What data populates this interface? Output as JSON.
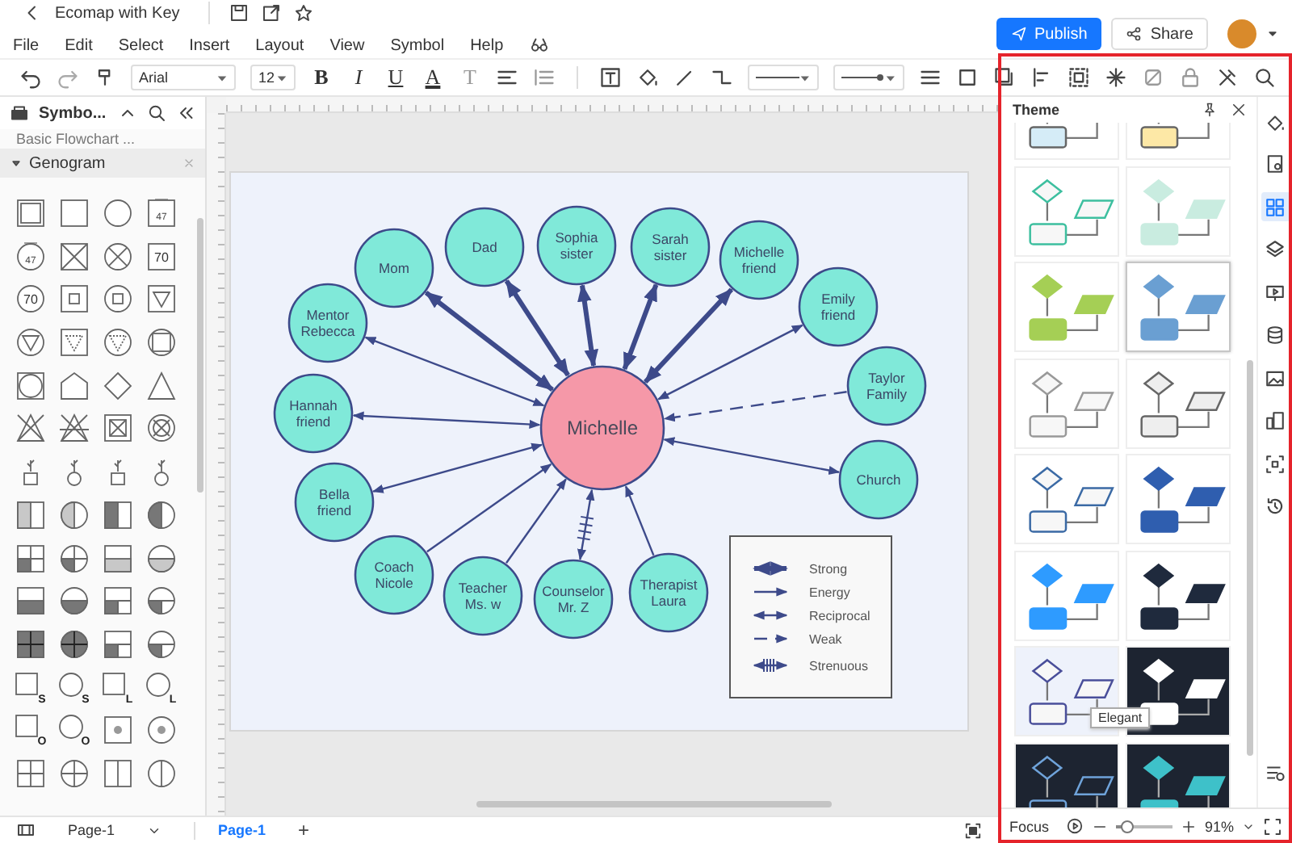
{
  "window": {
    "title": "Ecomap with Key"
  },
  "menu": [
    "File",
    "Edit",
    "Select",
    "Insert",
    "Layout",
    "View",
    "Symbol",
    "Help"
  ],
  "header_buttons": {
    "publish": "Publish",
    "share": "Share"
  },
  "toolbar": {
    "font": "Arial",
    "size": "12",
    "format": [
      "B",
      "I",
      "U",
      "A",
      "T"
    ]
  },
  "symbols_panel": {
    "title": "Symbo...",
    "library": "Basic Flowchart ...",
    "section": {
      "label": "Genogram",
      "expanded": true
    },
    "symbols": [
      {
        "kind": "square-double"
      },
      {
        "kind": "square"
      },
      {
        "kind": "circle"
      },
      {
        "kind": "square-age",
        "label": "47"
      },
      {
        "kind": "circle-age",
        "label": "47"
      },
      {
        "kind": "square-cross"
      },
      {
        "kind": "circle-cross"
      },
      {
        "kind": "square-label",
        "label": "70"
      },
      {
        "kind": "circle-label",
        "label": "70"
      },
      {
        "kind": "square-box"
      },
      {
        "kind": "circle-box"
      },
      {
        "kind": "square-triangle"
      },
      {
        "kind": "circle-triangle"
      },
      {
        "kind": "square-dtriangle"
      },
      {
        "kind": "circle-dtriangle"
      },
      {
        "kind": "circle-bigbox"
      },
      {
        "kind": "square-ring"
      },
      {
        "kind": "pentagon"
      },
      {
        "kind": "diamond"
      },
      {
        "kind": "triangle"
      },
      {
        "kind": "triangle-x"
      },
      {
        "kind": "triangle-xbar"
      },
      {
        "kind": "square-xbox"
      },
      {
        "kind": "circle-xring"
      },
      {
        "kind": "square-pregnancy"
      },
      {
        "kind": "circle-pregnancy"
      },
      {
        "kind": "square-pregnancy"
      },
      {
        "kind": "circle-pregnancy"
      },
      {
        "kind": "square-halfhatch"
      },
      {
        "kind": "circle-halfhatch"
      },
      {
        "kind": "square-halffill"
      },
      {
        "kind": "circle-halffill"
      },
      {
        "kind": "square-quarter"
      },
      {
        "kind": "circle-quarter"
      },
      {
        "kind": "square-bottomhatch"
      },
      {
        "kind": "circle-bottomhatch"
      },
      {
        "kind": "square-bottomfill"
      },
      {
        "kind": "circle-bottomfill"
      },
      {
        "kind": "square-quarter2"
      },
      {
        "kind": "circle-quarter2"
      },
      {
        "kind": "square-fourfill"
      },
      {
        "kind": "circle-fourfill"
      },
      {
        "kind": "square-quarter2"
      },
      {
        "kind": "circle-quarter2"
      },
      {
        "kind": "square-sub",
        "label": "S"
      },
      {
        "kind": "circle-sub",
        "label": "S"
      },
      {
        "kind": "square-sub",
        "label": "L"
      },
      {
        "kind": "circle-sub",
        "label": "L"
      },
      {
        "kind": "square-sub",
        "label": "O"
      },
      {
        "kind": "circle-sub",
        "label": "O"
      },
      {
        "kind": "square-dot"
      },
      {
        "kind": "circle-dot"
      },
      {
        "kind": "square-plus"
      },
      {
        "kind": "circle-plus"
      },
      {
        "kind": "square-split"
      },
      {
        "kind": "circle-split"
      }
    ]
  },
  "canvas": {
    "center": {
      "label": "Michelle"
    },
    "nodes": [
      {
        "label": [
          "Mom"
        ],
        "kind": "strong"
      },
      {
        "label": [
          "Dad"
        ],
        "kind": "strong"
      },
      {
        "label": [
          "Sophia",
          "sister"
        ],
        "kind": "strong"
      },
      {
        "label": [
          "Sarah",
          "sister"
        ],
        "kind": "strong"
      },
      {
        "label": [
          "Michelle",
          "friend"
        ],
        "kind": "strong"
      },
      {
        "label": [
          "Emily",
          "friend"
        ],
        "kind": "reciprocal"
      },
      {
        "label": [
          "Taylor",
          "Family"
        ],
        "kind": "weak"
      },
      {
        "label": [
          "Church"
        ],
        "kind": "reciprocal"
      },
      {
        "label": [
          "Mentor",
          "Rebecca"
        ],
        "kind": "reciprocal"
      },
      {
        "label": [
          "Hannah",
          "friend"
        ],
        "kind": "reciprocal"
      },
      {
        "label": [
          "Bella",
          "friend"
        ],
        "kind": "reciprocal"
      },
      {
        "label": [
          "Coach",
          "Nicole"
        ],
        "kind": "energy"
      },
      {
        "label": [
          "Teacher",
          "Ms. w"
        ],
        "kind": "energy"
      },
      {
        "label": [
          "Counselor",
          "Mr. Z"
        ],
        "kind": "strenuous"
      },
      {
        "label": [
          "Therapist",
          "Laura"
        ],
        "kind": "energy"
      }
    ],
    "legend": [
      {
        "kind": "strong",
        "label": "Strong"
      },
      {
        "kind": "energy",
        "label": "Energy"
      },
      {
        "kind": "reciprocal",
        "label": "Reciprocal"
      },
      {
        "kind": "weak",
        "label": "Weak"
      },
      {
        "kind": "strenuous",
        "label": "Strenuous"
      }
    ]
  },
  "pages": {
    "current": "Page-1",
    "tabs": [
      {
        "label": "Page-1",
        "selected": true
      }
    ],
    "add": "+"
  },
  "theme_panel": {
    "title": "Theme",
    "tooltip": "Elegant",
    "themes": [
      {
        "kind": "pastel",
        "color": "#d5ecf7",
        "selected": false,
        "hovered": false
      },
      {
        "kind": "pastel",
        "color": "#fde8a6",
        "selected": false,
        "hovered": false
      },
      {
        "kind": "outline",
        "color": "#3dbf9f",
        "selected": false,
        "hovered": false
      },
      {
        "kind": "filled",
        "color": "#c9ece0",
        "selected": false,
        "hovered": false
      },
      {
        "kind": "filled",
        "color": "#a5cf55",
        "selected": false,
        "hovered": false
      },
      {
        "kind": "filled",
        "color": "#6a9fd2",
        "selected": true,
        "hovered": false
      },
      {
        "kind": "outline",
        "color": "#999999",
        "selected": false,
        "hovered": false
      },
      {
        "kind": "pastel",
        "color": "#eeeeee",
        "selected": false,
        "hovered": false
      },
      {
        "kind": "outline",
        "color": "#3b6aa5",
        "selected": false,
        "hovered": false
      },
      {
        "kind": "filled",
        "color": "#2f5eaf",
        "selected": false,
        "hovered": false
      },
      {
        "kind": "filled",
        "color": "#2e9bff",
        "selected": false,
        "hovered": false
      },
      {
        "kind": "filled",
        "color": "#1f2a3d",
        "selected": false,
        "hovered": false
      },
      {
        "kind": "outline",
        "color": "#4a4f9a",
        "selected": false,
        "hovered": true
      },
      {
        "kind": "dark-filled",
        "color": "#ffffff",
        "selected": false,
        "hovered": false
      },
      {
        "kind": "dark-outline",
        "color": "#6fa3da",
        "selected": false,
        "hovered": false
      },
      {
        "kind": "dark-filled",
        "color": "#3ec1c9",
        "selected": false,
        "hovered": false
      }
    ]
  },
  "side_tools": [
    {
      "selected": false
    },
    {
      "selected": false
    },
    {
      "selected": true
    },
    {
      "selected": false
    },
    {
      "selected": false
    },
    {
      "selected": false
    },
    {
      "selected": false
    },
    {
      "selected": false
    },
    {
      "selected": false
    },
    {
      "selected": false
    },
    {
      "selected": false
    }
  ],
  "status": {
    "focus": "Focus",
    "zoom": {
      "level": 0.2,
      "reading": "91%"
    }
  }
}
